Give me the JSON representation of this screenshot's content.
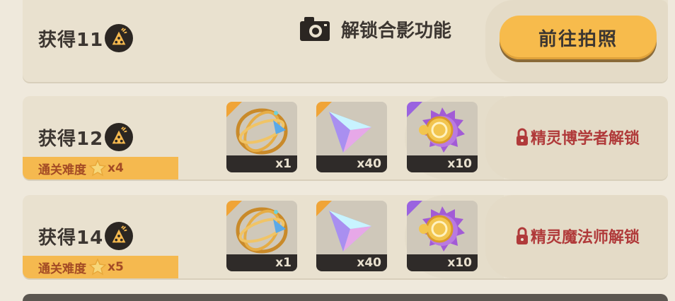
{
  "rows": [
    {
      "title": "获得11",
      "unlock_text": "解锁合影功能",
      "button_label": "前往拍照"
    },
    {
      "title": "获得12",
      "difficulty_label": "通关难度",
      "difficulty_mult": "x4",
      "items": [
        {
          "icon": "armillary-icon",
          "qty": "x1",
          "rarity": "orange"
        },
        {
          "icon": "crystal-icon",
          "qty": "x40",
          "rarity": "orange"
        },
        {
          "icon": "purple-coin-icon",
          "qty": "x10",
          "rarity": "purple"
        }
      ],
      "lock_text": "精灵博学者解锁"
    },
    {
      "title": "获得14",
      "difficulty_label": "通关难度",
      "difficulty_mult": "x5",
      "items": [
        {
          "icon": "armillary-icon",
          "qty": "x1",
          "rarity": "orange"
        },
        {
          "icon": "crystal-icon",
          "qty": "x40",
          "rarity": "orange"
        },
        {
          "icon": "purple-coin-icon",
          "qty": "x10",
          "rarity": "purple"
        }
      ],
      "lock_text": "精灵魔法师解锁"
    }
  ],
  "colors": {
    "accent": "#f7bb4c",
    "lock_red": "#b03a3a",
    "rarity_orange": "#f0a437",
    "rarity_purple": "#9a63e0"
  }
}
